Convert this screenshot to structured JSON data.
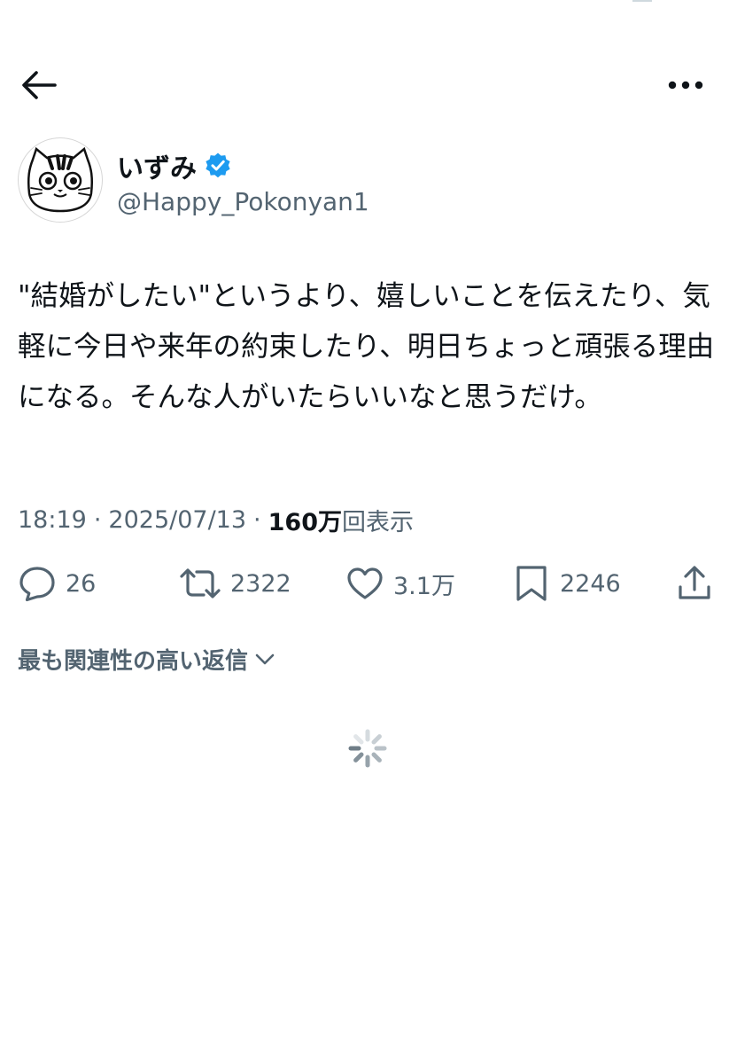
{
  "header": {
    "back_icon": "arrow-left-icon",
    "more_icon": "ellipsis-icon"
  },
  "tweet": {
    "author": {
      "display_name": "いずみ",
      "handle": "@Happy_Pokonyan1",
      "verified": true,
      "verified_color": "#1d9bf0",
      "avatar_icon": "cat-face-icon"
    },
    "text": "\"結婚がしたい\"というより、嬉しいことを伝えたり、気軽に今日や来年の約束したり、明日ちょっと頑張る理由になる。そんな人がいたらいいなと思うだけ。",
    "time": "18:19",
    "separator": "·",
    "date": "2025/07/13",
    "views_count": "160万",
    "views_label": "回表示"
  },
  "actions": {
    "replies": "26",
    "reposts": "2322",
    "likes": "3.1万",
    "bookmarks": "2246"
  },
  "replies_sort": {
    "label": "最も関連性の高い返信"
  },
  "colors": {
    "text_primary": "#0f1419",
    "text_secondary": "#536471",
    "accent": "#1d9bf0"
  }
}
